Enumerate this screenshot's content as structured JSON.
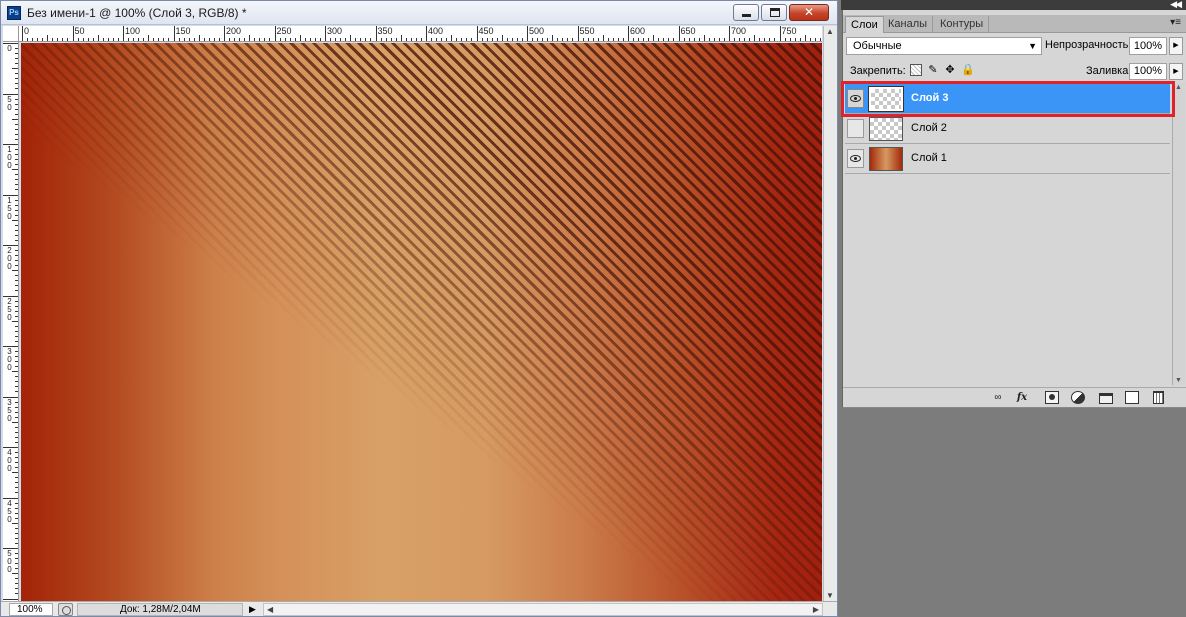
{
  "document": {
    "title": "Без имени-1 @ 100% (Слой 3, RGB/8) *",
    "app_icon": "Ps",
    "window_buttons": [
      "minimize-icon",
      "maximize-icon",
      "close-icon"
    ],
    "ruler_top_labels": [
      "0",
      "50",
      "100",
      "150",
      "200",
      "250",
      "300",
      "350",
      "400",
      "450",
      "500",
      "550",
      "600",
      "650",
      "700",
      "750"
    ],
    "ruler_left_labels": [
      "0",
      "50",
      "100",
      "150",
      "200",
      "250",
      "300",
      "350",
      "400",
      "450",
      "500",
      "5"
    ],
    "canvas_colors": {
      "edge": "#a32308",
      "center": "#d8a066",
      "stripe": "#46140a"
    }
  },
  "status": {
    "zoom": "100%",
    "doc_info": "Док: 1,28M/2,04M"
  },
  "panel": {
    "tabs": [
      "Слои",
      "Каналы",
      "Контуры"
    ],
    "active_tab": "Слои",
    "blend_mode": "Обычные",
    "opacity_label": "Непрозрачность:",
    "opacity_value": "100%",
    "lock_label": "Закрепить:",
    "fill_label": "Заливка:",
    "fill_value": "100%",
    "layers": [
      {
        "name": "Слой 3",
        "visible": true,
        "selected": true,
        "thumb": "transparent"
      },
      {
        "name": "Слой 2",
        "visible": false,
        "selected": false,
        "thumb": "transparent"
      },
      {
        "name": "Слой 1",
        "visible": true,
        "selected": false,
        "thumb": "gradient"
      }
    ],
    "bottom_tools": [
      "link-icon",
      "fx-icon",
      "mask-icon",
      "adjustment-icon",
      "group-icon",
      "new-layer-icon",
      "trash-icon"
    ],
    "fx_label": "fx",
    "highlight_color": "#e0232b",
    "selection_color": "#3a95f7"
  }
}
